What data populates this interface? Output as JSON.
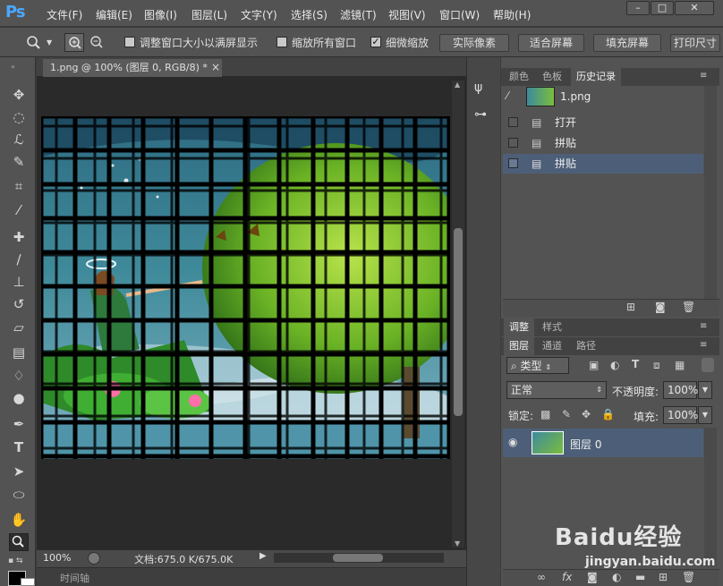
{
  "app": {
    "logo": "Ps"
  },
  "menu": [
    "文件(F)",
    "编辑(E)",
    "图像(I)",
    "图层(L)",
    "文字(Y)",
    "选择(S)",
    "滤镜(T)",
    "视图(V)",
    "窗口(W)",
    "帮助(H)"
  ],
  "window_buttons": {
    "minimize": "–",
    "restore": "□",
    "close": "✕"
  },
  "options": {
    "resize_windows_label": "调整窗口大小以满屏显示",
    "zoom_all_label": "缩放所有窗口",
    "scrubby_zoom_label": "细微缩放",
    "scrubby_zoom_checked": true,
    "actual_pixels": "实际像素",
    "fit_screen": "适合屏幕",
    "fill_screen": "填充屏幕",
    "print_size": "打印尺寸"
  },
  "document": {
    "tab_title": "1.png @ 100% (图层 0, RGB/8) *",
    "tab_close": "×",
    "zoom": "100%",
    "doc_size": "文档:675.0 K/675.0K",
    "timeline_label": "时间轴"
  },
  "history_panel": {
    "tabs": [
      "颜色",
      "色板",
      "历史记录"
    ],
    "active_tab": "历史记录",
    "snapshot": "1.png",
    "items": [
      {
        "label": "打开",
        "selected": false
      },
      {
        "label": "拼贴",
        "selected": false
      },
      {
        "label": "拼贴",
        "selected": true
      }
    ]
  },
  "adjust_tabs": [
    "调整",
    "样式"
  ],
  "layers_panel": {
    "tabs": [
      "图层",
      "通道",
      "路径"
    ],
    "filter_kind": "类型",
    "blend_mode": "正常",
    "opacity_label": "不透明度:",
    "opacity": "100%",
    "lock_label": "锁定:",
    "fill_label": "填充:",
    "fill": "100%",
    "layers": [
      {
        "name": "图层 0",
        "visible": true
      }
    ]
  },
  "watermark": {
    "brand": "Baidu经验",
    "url": "jingyan.baidu.com"
  },
  "colors": {
    "selection": "#4d5f78",
    "panel": "#535353",
    "canvas_bg": "#2a2a2a"
  }
}
